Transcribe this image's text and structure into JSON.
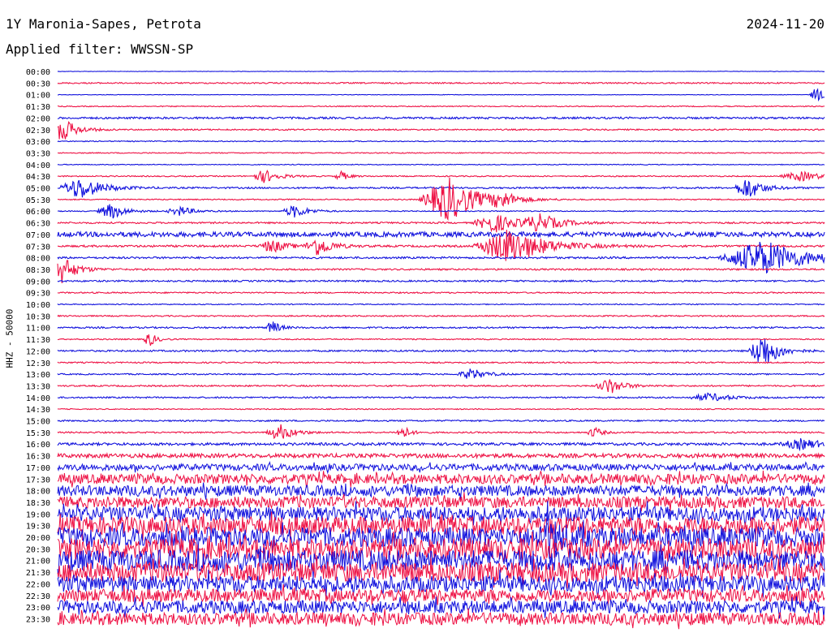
{
  "header": {
    "station": "1Y Maronia-Sapes, Petrota",
    "filter": "Applied filter: WWSSN-SP",
    "date": "2024-11-20"
  },
  "colors": {
    "blue": "#1111dd",
    "red": "#ee1144"
  },
  "chart_data": {
    "type": "line",
    "title": "1Y Maronia-Sapes, Petrota",
    "subtitle": "Applied filter: WWSSN-SP",
    "ylabel": "HHZ - 50000",
    "row_labels": [
      "00:00",
      "00:30",
      "01:00",
      "01:30",
      "02:00",
      "02:30",
      "03:00",
      "03:30",
      "04:00",
      "04:30",
      "05:00",
      "05:30",
      "06:00",
      "06:30",
      "07:00",
      "07:30",
      "08:00",
      "08:30",
      "09:00",
      "09:30",
      "10:00",
      "10:30",
      "11:00",
      "11:30",
      "12:00",
      "12:30",
      "13:00",
      "13:30",
      "14:00",
      "14:30",
      "15:00",
      "15:30",
      "16:00",
      "16:30",
      "17:00",
      "17:30",
      "18:00",
      "18:30",
      "19:00",
      "19:30",
      "20:00",
      "20:30",
      "21:00",
      "21:30",
      "22:00",
      "22:30",
      "23:00",
      "23:30"
    ],
    "row_colors": [
      "blue",
      "red"
    ],
    "noise_levels": [
      0.3,
      0.8,
      0.3,
      0.6,
      1.2,
      0.8,
      0.6,
      0.6,
      0.5,
      0.7,
      1.0,
      0.7,
      0.6,
      1.0,
      3.0,
      1.2,
      1.2,
      1.0,
      1.0,
      0.8,
      0.6,
      0.8,
      1.0,
      0.7,
      1.0,
      0.8,
      0.8,
      0.9,
      0.9,
      0.6,
      0.9,
      0.9,
      1.6,
      2.5,
      4.0,
      6.0,
      6.5,
      7.0,
      9.0,
      11.0,
      12.0,
      13.0,
      13.0,
      12.0,
      10.0,
      8.0,
      8.0,
      7.5
    ],
    "events": [
      {
        "row": 2,
        "x": 0.99,
        "amp": 10,
        "width": 0.01
      },
      {
        "row": 5,
        "x": 0.005,
        "amp": 16,
        "width": 0.02
      },
      {
        "row": 9,
        "x": 0.27,
        "amp": 8,
        "width": 0.02
      },
      {
        "row": 9,
        "x": 0.37,
        "amp": 6,
        "width": 0.01
      },
      {
        "row": 9,
        "x": 0.97,
        "amp": 6,
        "width": 0.03
      },
      {
        "row": 10,
        "x": 0.03,
        "amp": 14,
        "width": 0.03
      },
      {
        "row": 10,
        "x": 0.9,
        "amp": 14,
        "width": 0.02
      },
      {
        "row": 11,
        "x": 0.51,
        "amp": 28,
        "width": 0.04
      },
      {
        "row": 11,
        "x": 0.58,
        "amp": 8,
        "width": 0.02
      },
      {
        "row": 12,
        "x": 0.07,
        "amp": 10,
        "width": 0.02
      },
      {
        "row": 12,
        "x": 0.16,
        "amp": 6,
        "width": 0.02
      },
      {
        "row": 12,
        "x": 0.31,
        "amp": 8,
        "width": 0.02
      },
      {
        "row": 13,
        "x": 0.57,
        "amp": 12,
        "width": 0.03
      },
      {
        "row": 13,
        "x": 0.63,
        "amp": 10,
        "width": 0.03
      },
      {
        "row": 15,
        "x": 0.28,
        "amp": 8,
        "width": 0.02
      },
      {
        "row": 15,
        "x": 0.34,
        "amp": 12,
        "width": 0.02
      },
      {
        "row": 15,
        "x": 0.59,
        "amp": 22,
        "width": 0.05
      },
      {
        "row": 16,
        "x": 0.92,
        "amp": 22,
        "width": 0.06
      },
      {
        "row": 17,
        "x": 0.005,
        "amp": 18,
        "width": 0.02
      },
      {
        "row": 22,
        "x": 0.28,
        "amp": 9,
        "width": 0.01
      },
      {
        "row": 23,
        "x": 0.12,
        "amp": 9,
        "width": 0.01
      },
      {
        "row": 24,
        "x": 0.92,
        "amp": 24,
        "width": 0.02
      },
      {
        "row": 26,
        "x": 0.54,
        "amp": 7,
        "width": 0.02
      },
      {
        "row": 27,
        "x": 0.72,
        "amp": 10,
        "width": 0.02
      },
      {
        "row": 28,
        "x": 0.85,
        "amp": 5,
        "width": 0.03
      },
      {
        "row": 31,
        "x": 0.29,
        "amp": 10,
        "width": 0.02
      },
      {
        "row": 31,
        "x": 0.45,
        "amp": 9,
        "width": 0.01
      },
      {
        "row": 31,
        "x": 0.7,
        "amp": 7,
        "width": 0.01
      },
      {
        "row": 32,
        "x": 0.97,
        "amp": 6,
        "width": 0.03
      },
      {
        "row": 40,
        "x": 0.64,
        "amp": 18,
        "width": 0.02
      }
    ]
  }
}
